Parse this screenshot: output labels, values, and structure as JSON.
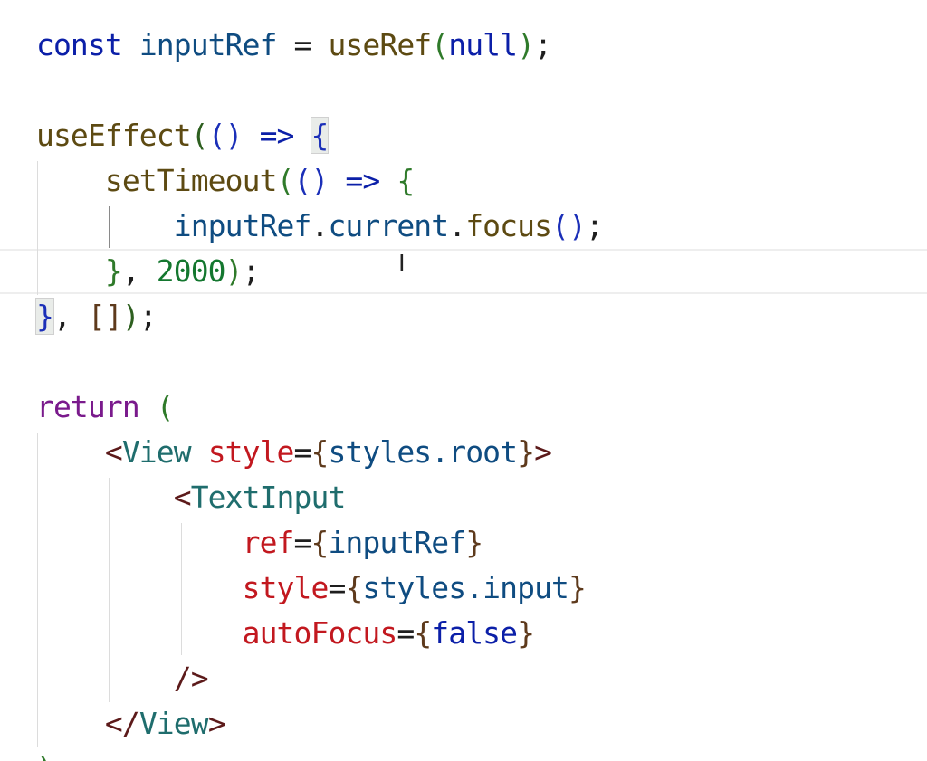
{
  "code": {
    "line1": {
      "kw_const": "const",
      "var": "inputRef",
      "eq": " = ",
      "fn": "useRef",
      "open": "(",
      "value": "null",
      "close": ")",
      "semi": ";"
    },
    "line3": {
      "fn": "useEffect",
      "open": "(",
      "params": "()",
      "arrow": " => ",
      "brace": "{"
    },
    "line4": {
      "indent": "    ",
      "fn": "setTimeout",
      "open": "(",
      "params": "()",
      "arrow": " => ",
      "brace": "{"
    },
    "line5": {
      "indent": "        ",
      "obj": "inputRef",
      "dot1": ".",
      "prop": "current",
      "dot2": ".",
      "method": "focus",
      "call": "()",
      "semi": ";"
    },
    "line6": {
      "indent": "    ",
      "brace": "}",
      "comma": ", ",
      "delay": "2000",
      "close": ")",
      "semi": ";"
    },
    "line7": {
      "brace": "}",
      "comma": ", ",
      "deps": "[]",
      "close": ")",
      "semi": ";"
    },
    "line9": {
      "kw_return": "return",
      "open": " ("
    },
    "line10": {
      "indent": "    ",
      "lt": "<",
      "tag": "View",
      "sp": " ",
      "attr": "style",
      "eq": "=",
      "ob": "{",
      "expr": "styles.root",
      "cb": "}",
      "gt": ">"
    },
    "line11": {
      "indent": "        ",
      "lt": "<",
      "tag": "TextInput"
    },
    "line12": {
      "indent": "            ",
      "attr": "ref",
      "eq": "=",
      "ob": "{",
      "expr": "inputRef",
      "cb": "}"
    },
    "line13": {
      "indent": "            ",
      "attr": "style",
      "eq": "=",
      "ob": "{",
      "expr": "styles.input",
      "cb": "}"
    },
    "line14": {
      "indent": "            ",
      "attr": "autoFocus",
      "eq": "=",
      "ob": "{",
      "expr": "false",
      "cb": "}"
    },
    "line15": {
      "indent": "        ",
      "selfclose": "/>"
    },
    "line16": {
      "indent": "    ",
      "close": "</",
      "tag": "View",
      "gt": ">"
    },
    "line17": {
      "paren": ")"
    }
  },
  "cursor_glyph": "I",
  "colors": {
    "keyword": "#0b1fa8",
    "return_keyword": "#7a1a8c",
    "function": "#5d4a12",
    "variable": "#0f4c81",
    "number": "#14772f",
    "jsx_tag": "#1f6d6d",
    "jsx_attribute": "#c2181f",
    "current_line": "#eeeeee"
  }
}
